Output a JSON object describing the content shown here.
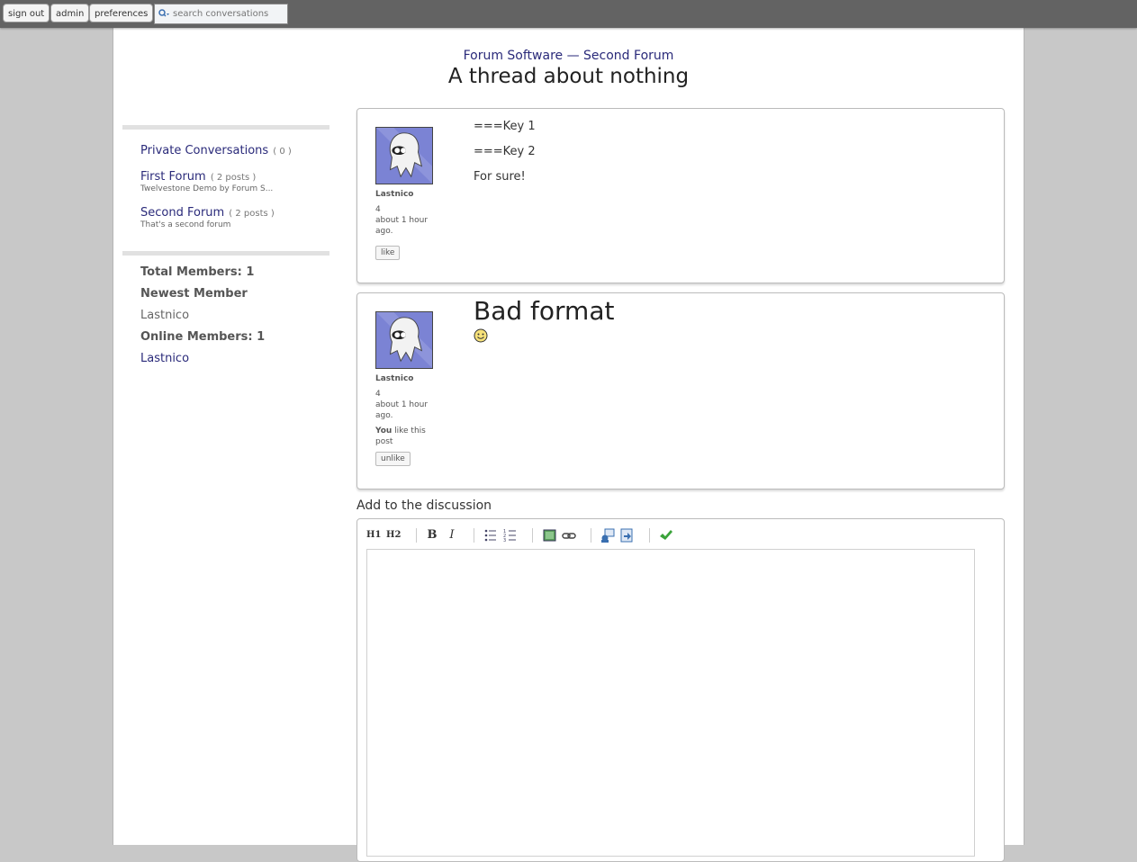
{
  "topbar": {
    "sign_out": "sign out",
    "admin": "admin",
    "preferences": "preferences",
    "search_placeholder": "search conversations"
  },
  "breadcrumb": {
    "site": "Forum Software",
    "separator": " — ",
    "forum": "Second Forum"
  },
  "page_title": "A thread about nothing",
  "sidebar": {
    "forums": [
      {
        "name": "Private Conversations",
        "count": "( 0 )",
        "desc": ""
      },
      {
        "name": "First Forum",
        "count": "( 2 posts )",
        "desc": "Twelvestone Demo by Forum S..."
      },
      {
        "name": "Second Forum",
        "count": "( 2 posts )",
        "desc": "That's a second forum"
      }
    ],
    "stats": {
      "total_members": "Total Members: 1",
      "newest_member_label": "Newest Member",
      "newest_member": "Lastnico",
      "online_members": "Online Members: 1",
      "online_member": "Lastnico"
    }
  },
  "posts": [
    {
      "author": "Lastnico",
      "post_count": "4",
      "time": "about 1 hour ago.",
      "lines": [
        "===Key 1",
        "===Key 2",
        "For sure!"
      ],
      "button": "like"
    },
    {
      "author": "Lastnico",
      "post_count": "4",
      "time": "about 1 hour ago.",
      "heading": "Bad format",
      "like_you": "You",
      "like_rest": " like this post",
      "button": "unlike"
    }
  ],
  "editor": {
    "label": "Add to the discussion",
    "tools": {
      "h1": "H1",
      "h2": "H2",
      "bold": "B",
      "italic": "I"
    }
  },
  "colors": {
    "topbar": "#636363",
    "background": "#c8c8c8",
    "link": "#2a2a7a",
    "avatar_bg": "#7b83d4"
  }
}
